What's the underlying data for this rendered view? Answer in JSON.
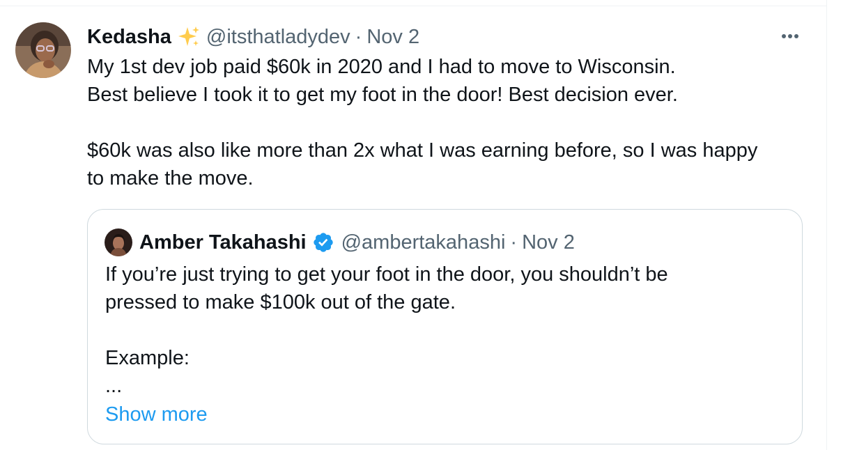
{
  "tweet": {
    "author_name": "Kedasha",
    "author_emoji": "sparkles-icon",
    "handle": "@itsthatladydev",
    "separator": "·",
    "date": "Nov 2",
    "more_icon": "more-horizontal-icon",
    "text_lines": [
      "My 1st dev job paid $60k in 2020 and I had to move to Wisconsin.",
      "Best believe I took it to get my foot in the door! Best decision ever.",
      "$60k was also like more than 2x what I was earning before, so I was happy",
      "to make the move."
    ]
  },
  "quote": {
    "author_name": "Amber Takahashi",
    "verified_icon": "verified-badge-icon",
    "handle": "@ambertakahashi",
    "separator": "·",
    "date": "Nov 2",
    "text_lines": [
      "If you’re just trying to get your foot in the door, you shouldn’t be",
      "pressed to make $100k out of the gate.",
      "Example:",
      "..."
    ],
    "show_more_label": "Show more"
  },
  "colors": {
    "text_primary": "#0f1419",
    "text_secondary": "#536471",
    "link": "#1d9bf0",
    "border": "#cfd9de",
    "verified": "#1d9bf0",
    "sparkle": "#ffcc4d"
  }
}
